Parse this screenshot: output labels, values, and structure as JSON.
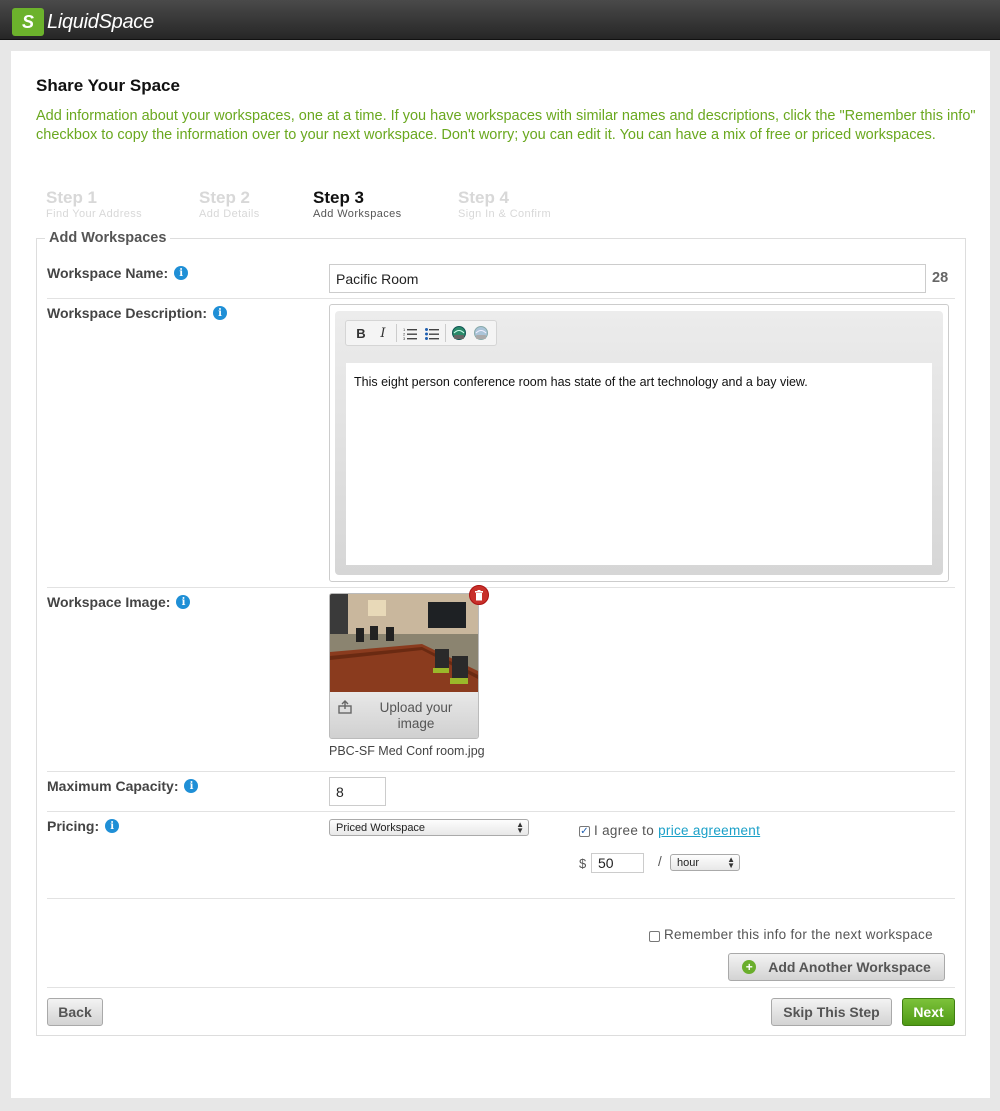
{
  "app": {
    "name": "LiquidSpace",
    "logo_mark": "S"
  },
  "page": {
    "title": "Share Your Space",
    "intro": "Add information about your workspaces, one at a time. If you have workspaces with similar names and descriptions, click the \"Remember this info\" checkbox to copy the information over to your next workspace. Don't worry; you can edit it. You can have a mix of free or priced workspaces."
  },
  "steps": [
    {
      "title": "Step 1",
      "subtitle": "Find Your Address",
      "active": false
    },
    {
      "title": "Step 2",
      "subtitle": "Add Details",
      "active": false
    },
    {
      "title": "Step 3",
      "subtitle": "Add Workspaces",
      "active": true
    },
    {
      "title": "Step 4",
      "subtitle": "Sign In & Confirm",
      "active": false
    }
  ],
  "form": {
    "legend": "Add Workspaces",
    "info_icon": "i",
    "name": {
      "label": "Workspace Name:",
      "value": "Pacific Room",
      "char_count": "28"
    },
    "description": {
      "label": "Workspace Description:",
      "toolbar": [
        "bold",
        "italic",
        "ordered-list",
        "unordered-list",
        "link",
        "unlink"
      ],
      "value": "This eight person conference room has state of the art technology and a bay view."
    },
    "image": {
      "label": "Workspace Image:",
      "upload_label": "Upload your image",
      "filename": "PBC-SF Med Conf room.jpg"
    },
    "capacity": {
      "label": "Maximum Capacity:",
      "value": "8"
    },
    "pricing": {
      "label": "Pricing:",
      "type_selected": "Priced Workspace",
      "agree_prefix": "I agree to",
      "agree_link": "price agreement",
      "agree_checked": true,
      "currency": "$",
      "price": "50",
      "per": "/",
      "unit_selected": "hour"
    },
    "remember_label": "Remember this info for the next workspace",
    "add_another_label": "Add Another Workspace"
  },
  "buttons": {
    "back": "Back",
    "skip": "Skip This Step",
    "next": "Next"
  },
  "colors": {
    "brand_green": "#6cb22c",
    "intro_green": "#6aa81f",
    "link_blue": "#1aa0c8",
    "info_blue": "#1f8fd6"
  }
}
